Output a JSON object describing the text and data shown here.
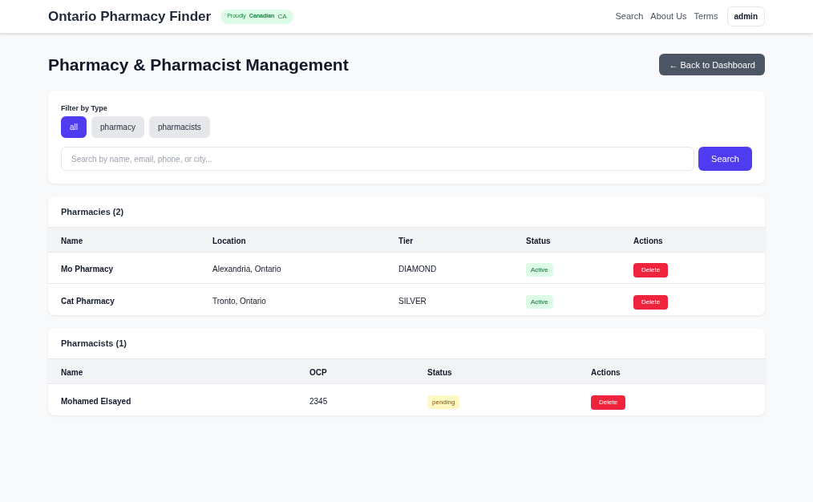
{
  "nav": {
    "brand": "Ontario Pharmacy Finder",
    "badge": {
      "prefix": "Proudly",
      "word": "Canadian",
      "suffix": "CA"
    },
    "links": [
      "Search",
      "About Us",
      "Terms"
    ],
    "user_button": "admin"
  },
  "page": {
    "title": "Pharmacy & Pharmacist Management",
    "back_button": "← Back to Dashboard"
  },
  "filter": {
    "label": "Filter by Type",
    "options": [
      {
        "label": "all",
        "selected": true
      },
      {
        "label": "pharmacy",
        "selected": false
      },
      {
        "label": "pharmacists",
        "selected": false
      }
    ],
    "search": {
      "placeholder": "Search by name, email, phone, or city...",
      "button": "Search"
    }
  },
  "tables": [
    {
      "title": "Pharmacies (2)",
      "columns": [
        "Name",
        "Location",
        "Tier",
        "Status",
        "Actions"
      ],
      "rows": [
        {
          "cells": [
            "Mo Pharmacy",
            "Alexandria, Ontario",
            "DIAMOND"
          ],
          "status": {
            "text": "Active",
            "kind": "active"
          },
          "action": "Delete"
        },
        {
          "cells": [
            "Cat Pharmacy",
            "Tronto, Ontario",
            "SILVER"
          ],
          "status": {
            "text": "Active",
            "kind": "active"
          },
          "action": "Delete"
        }
      ]
    },
    {
      "title": "Pharmacists (1)",
      "columns": [
        "Name",
        "OCP",
        "Status",
        "Actions"
      ],
      "rows": [
        {
          "cells": [
            "Mohamed Elsayed",
            "2345"
          ],
          "status": {
            "text": "pending",
            "kind": "pending"
          },
          "action": "Delete"
        }
      ]
    }
  ]
}
